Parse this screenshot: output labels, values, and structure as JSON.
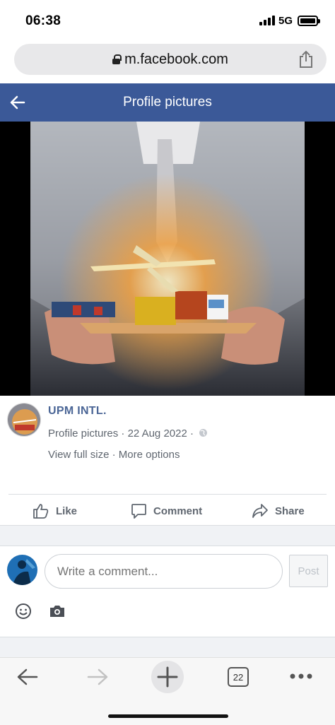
{
  "status_bar": {
    "time": "06:38",
    "network": "5G"
  },
  "browser": {
    "url": "m.facebook.com",
    "tab_count": "22"
  },
  "header": {
    "title": "Profile pictures"
  },
  "post": {
    "author": "UPM INTL.",
    "album": "Profile pictures",
    "date": "22 Aug 2022",
    "separator": "·",
    "view_full_size": "View full size",
    "more_options": "More options"
  },
  "actions": {
    "like": "Like",
    "comment": "Comment",
    "share": "Share"
  },
  "composer": {
    "placeholder": "Write a comment...",
    "post_label": "Post"
  },
  "colors": {
    "facebook_blue": "#3b5998",
    "author_link": "#4b6696",
    "meta_gray": "#606770"
  }
}
